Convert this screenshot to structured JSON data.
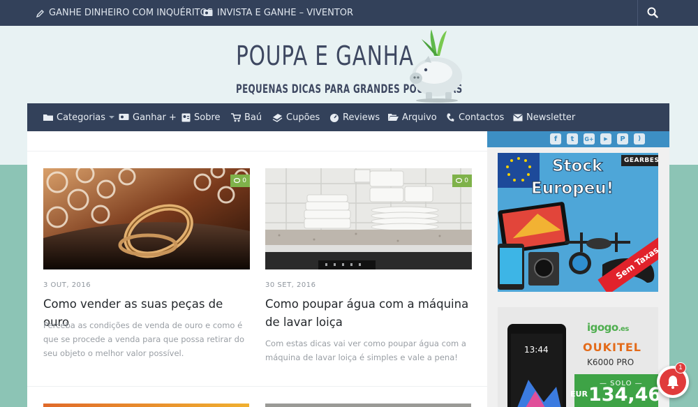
{
  "topbar": {
    "link1": "GANHE DINHEIRO COM INQUÉRITOS",
    "link2": "INVISTA E GANHE – VIVENTOR"
  },
  "header": {
    "logo_title": "POUPA E GANHA",
    "logo_tagline": "PEQUENAS DICAS PARA GRANDES POUPANÇAS"
  },
  "nav": {
    "items": [
      {
        "label": "Categorias",
        "icon": "folder-icon"
      },
      {
        "label": "Ganhar +",
        "icon": "money-icon"
      },
      {
        "label": "Sobre",
        "icon": "profile-icon"
      },
      {
        "label": "Baú",
        "icon": "cart-icon"
      },
      {
        "label": "Cupões",
        "icon": "coupon-icon"
      },
      {
        "label": "Reviews",
        "icon": "gauge-icon"
      },
      {
        "label": "Arquivo",
        "icon": "folder-open-icon"
      },
      {
        "label": "Contactos",
        "icon": "phone-icon"
      },
      {
        "label": "Newsletter",
        "icon": "envelope-icon"
      }
    ]
  },
  "posts": [
    {
      "comments": "0",
      "date": "3 OUT, 2016",
      "title": "Como vender as suas peças de ouro",
      "excerpt": "Perceba as condições de venda de ouro e como é que se procede a venda para que possa retirar do seu objeto o melhor valor possível."
    },
    {
      "comments": "0",
      "date": "30 SET, 2016",
      "title": "Como poupar água com a máquina de lavar loiça",
      "excerpt": "Com estas dicas vai ver como poupar água com a máquina de lavar loiça é simples e vale a pena!"
    }
  ],
  "sidebar": {
    "social_icons": [
      "facebook-icon",
      "twitter-icon",
      "google-plus-icon",
      "youtube-icon",
      "pinterest-icon",
      "rss-icon"
    ],
    "ad1": {
      "line1": "Stock",
      "line2": "Europeu!",
      "brand": "GEARBEST",
      "ribbon": "Sem Taxas"
    },
    "ad2": {
      "shop": "igogo",
      "shop_tld": ".es",
      "brand": "OUKITEL",
      "model": "K6000 PRO",
      "solo": "— SOLO —",
      "currency": "EUR",
      "price": "134,46",
      "phone_time": "13:44"
    }
  },
  "notification": {
    "count": "1"
  },
  "colors": {
    "nav": "#33415a",
    "accent": "#7fb24a",
    "social_bar": "#3d8fc4",
    "teal_bg": "#8cc4b5"
  }
}
